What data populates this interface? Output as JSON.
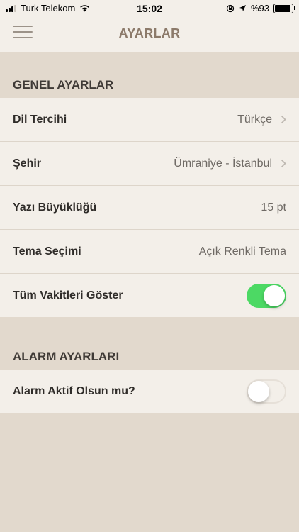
{
  "status_bar": {
    "carrier": "Turk Telekom",
    "time": "15:02",
    "battery": "%93",
    "battery_level": 0.93,
    "signal_bars": 3
  },
  "nav": {
    "title": "AYARLAR",
    "menu_icon": "hamburger-menu-icon"
  },
  "general": {
    "header": "GENEL AYARLAR",
    "rows": [
      {
        "label": "Dil Tercihi",
        "value": "Türkçe"
      },
      {
        "label": "Şehir",
        "value": "Ümraniye - İstanbul"
      },
      {
        "label": "Yazı Büyüklüğü",
        "value": "15 pt"
      },
      {
        "label": "Tema Seçimi",
        "value": "Açık Renkli Tema"
      },
      {
        "label": "Tüm Vakitleri Göster",
        "toggle": true
      }
    ]
  },
  "alarm": {
    "header": "ALARM AYARLARI",
    "rows": [
      {
        "label": "Alarm Aktif Olsun mu?",
        "toggle": false
      }
    ]
  },
  "colors": {
    "background": "#e2d9cd",
    "surface": "#f3efe9",
    "accent_title": "#8c7a6a",
    "toggle_on": "#4cd964"
  }
}
